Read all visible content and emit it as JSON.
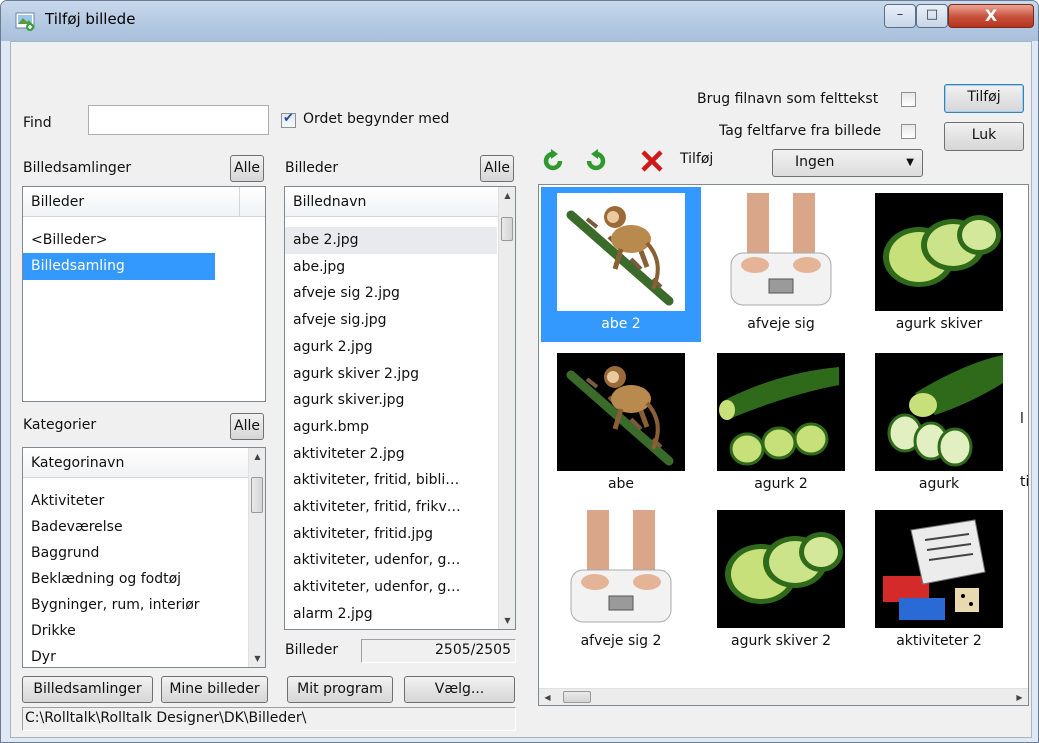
{
  "window": {
    "title": "Tilføj billede",
    "minimize_glyph": "–",
    "maximize_glyph": "□",
    "close_glyph": "X"
  },
  "find": {
    "label": "Find",
    "value": "",
    "starts_with_label": "Ordet begynder med",
    "starts_with_checked": true
  },
  "options": {
    "use_filename_label": "Brug filnavn som felttekst",
    "use_filename_checked": false,
    "field_color_label": "Tag feltfarve fra billede",
    "field_color_checked": false,
    "add_button": "Tilføj",
    "close_button": "Luk"
  },
  "collections": {
    "title": "Billedsamlinger",
    "all_button": "Alle",
    "header": "Billeder",
    "items": [
      "<Billeder>",
      "Billedsamling"
    ],
    "selected_index": 1
  },
  "categories": {
    "title": "Kategorier",
    "all_button": "Alle",
    "header": "Kategorinavn",
    "items": [
      "Aktiviteter",
      "Badeværelse",
      "Baggrund",
      "Beklædning og fodtøj",
      "Bygninger, rum, interiør",
      "Drikke",
      "Dyr"
    ]
  },
  "images": {
    "title": "Billeder",
    "all_button": "Alle",
    "header": "Billednavn",
    "items": [
      "abe 2.jpg",
      "abe.jpg",
      "afveje sig 2.jpg",
      "afveje sig.jpg",
      "agurk 2.jpg",
      "agurk skiver 2.jpg",
      "agurk skiver.jpg",
      "agurk.bmp",
      "aktiviteter 2.jpg",
      "aktiviteter, fritid, bibli…",
      "aktiviteter, fritid, frikv…",
      "aktiviteter, fritid.jpg",
      "aktiviteter, udenfor, g…",
      "aktiviteter, udenfor, g…",
      "alarm 2.jpg"
    ],
    "highlighted_index": 0,
    "count_label": "Billeder",
    "count_value": "2505/2505"
  },
  "toolbar": {
    "rotate_left_icon": "rotate-left-icon",
    "rotate_right_icon": "rotate-right-icon",
    "delete_icon": "delete-icon",
    "add_label": "Tilføj",
    "add_select_value": "Ingen"
  },
  "gallery": {
    "tiles": [
      {
        "caption": "abe 2",
        "kind": "monkey",
        "selected": true
      },
      {
        "caption": "afveje sig",
        "kind": "scale",
        "selected": false
      },
      {
        "caption": "agurk skiver",
        "kind": "slices",
        "selected": false
      },
      {
        "caption": "abe",
        "kind": "monkey",
        "selected": false
      },
      {
        "caption": "agurk 2",
        "kind": "cucumber",
        "selected": false
      },
      {
        "caption": "agurk",
        "kind": "cucumber2",
        "selected": false
      },
      {
        "caption": "afveje sig 2",
        "kind": "scale",
        "selected": false
      },
      {
        "caption": "agurk skiver 2",
        "kind": "slices",
        "selected": false
      },
      {
        "caption": "aktiviteter 2",
        "kind": "activity",
        "selected": false
      }
    ],
    "partial_letters": [
      "l",
      "ti"
    ]
  },
  "bottom": {
    "collections_button": "Billedsamlinger",
    "my_images_button": "Mine billeder",
    "my_program_button": "Mit program",
    "choose_button": "Vælg...",
    "path": "C:\\Rolltalk\\Rolltalk Designer\\DK\\Billeder\\"
  },
  "colors": {
    "selection": "#3399ff",
    "rotate_green": "#2e9a2e",
    "delete_red": "#d01818"
  }
}
